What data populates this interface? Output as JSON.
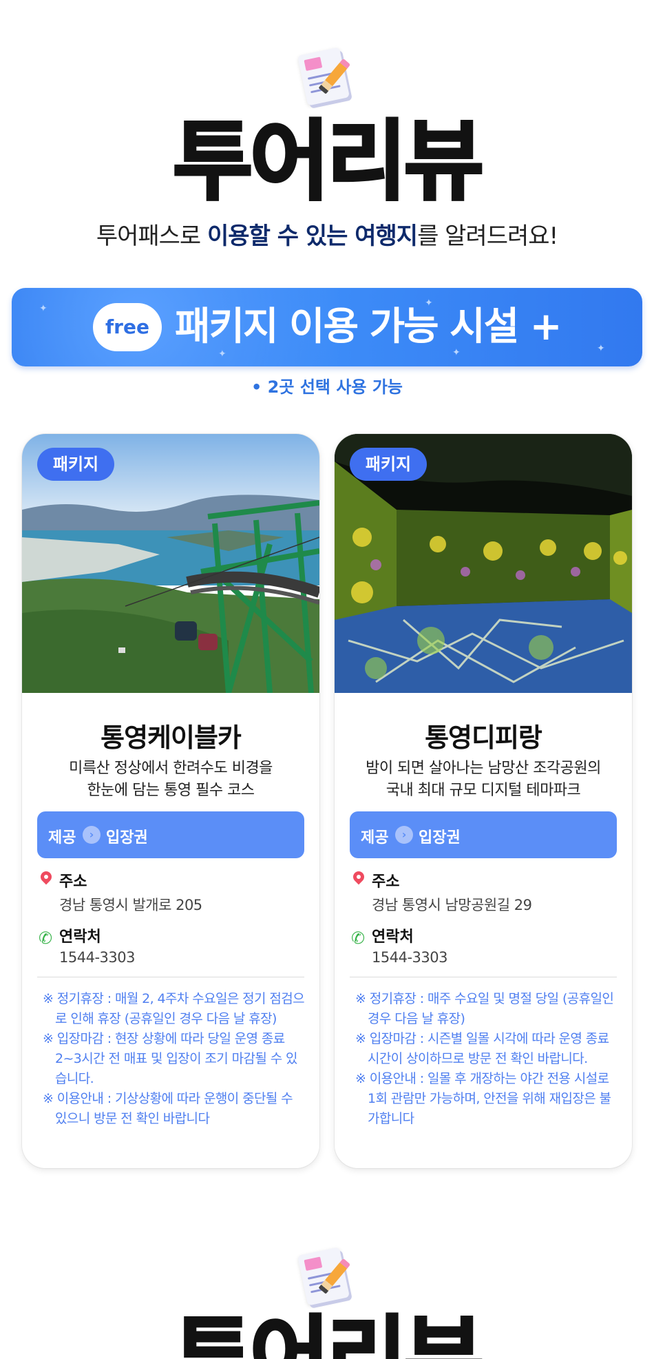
{
  "header": {
    "title": "투어리뷰",
    "subtitle_pre": "투어패스로 ",
    "subtitle_highlight_1": "이용할 수 있는 여행지",
    "subtitle_post": "를 알려드려요!"
  },
  "banner": {
    "free_label": "free",
    "title": "패키지 이용 가능 시설 +",
    "note": "• 2곳 선택 사용 가능"
  },
  "cards": [
    {
      "badge": "패키지",
      "title": "통영케이블카",
      "desc_line1": "미륵산 정상에서 한려수도 비경을",
      "desc_line2": "한눈에 담는 통영 필수 코스",
      "provide_label": "제공",
      "provide_value": "입장권",
      "address_label": "주소",
      "address": "경남 통영시 발개로 205",
      "contact_label": "연락처",
      "contact": "1544-3303",
      "notes": [
        "※ 정기휴장 : 매월 2, 4주차 수요일은 정기 점검으로 인해 휴장 (공휴일인 경우 다음 날 휴장)",
        "※ 입장마감 : 현장 상황에 따라 당일 운영 종료 2~3시간 전 매표 및 입장이 조기 마감될 수 있습니다.",
        "※ 이용안내 : 기상상황에 따라 운행이 중단될 수 있으니 방문 전 확인 바랍니다"
      ]
    },
    {
      "badge": "패키지",
      "title": "통영디피랑",
      "desc_line1": "밤이 되면 살아나는 남망산 조각공원의",
      "desc_line2": "국내 최대 규모 디지털 테마파크",
      "provide_label": "제공",
      "provide_value": "입장권",
      "address_label": "주소",
      "address": "경남 통영시 남망공원길 29",
      "contact_label": "연락처",
      "contact": "1544-3303",
      "notes": [
        "※ 정기휴장 : 매주 수요일 및 명절 당일 (공휴일인 경우 다음 날 휴장)",
        "※ 입장마감 : 시즌별 일몰 시각에 따라 운영 종료 시간이 상이하므로 방문 전 확인 바랍니다.",
        "※ 이용안내 : 일몰 후 개장하는 야간 전용 시설로 1회 관람만 가능하며, 안전을 위해 재입장은 불가합니다"
      ]
    }
  ],
  "footer_header": {
    "title": "투어리뷰"
  },
  "icons": [
    "notepad-pencil-icon",
    "location-pin-icon",
    "phone-icon",
    "chevron-right-icon"
  ],
  "colors": {
    "accent_blue": "#3d86f5",
    "box_blue": "#5b8ef7",
    "notes_blue": "#4f7ff0",
    "pin_red": "#ef4b5f",
    "phone_green": "#38b34a"
  }
}
